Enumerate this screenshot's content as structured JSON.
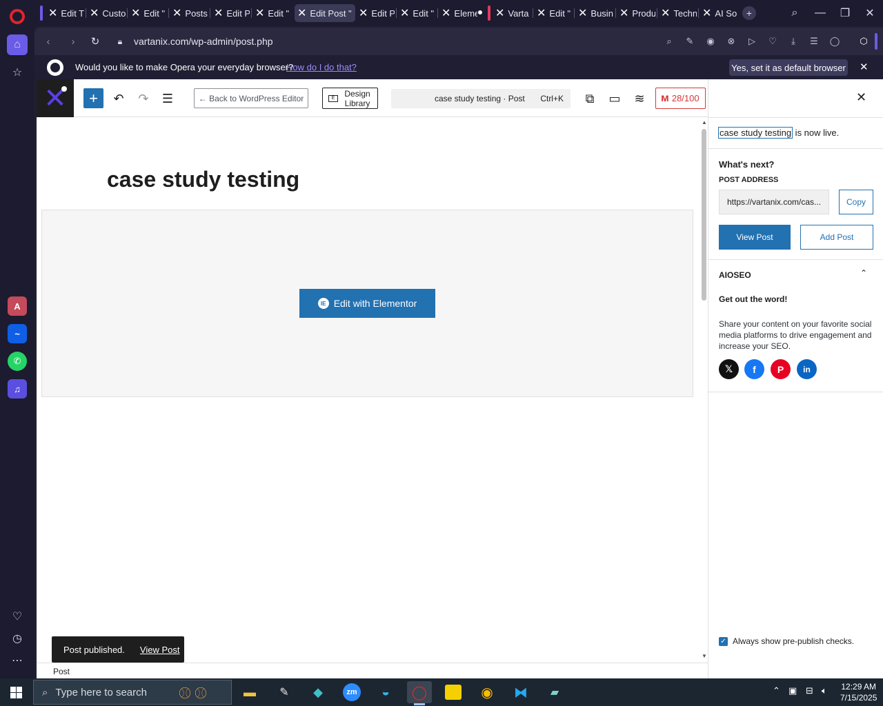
{
  "browser": {
    "tabs": [
      {
        "label": "Edit T"
      },
      {
        "label": "Custo"
      },
      {
        "label": "Edit \""
      },
      {
        "label": "Posts"
      },
      {
        "label": "Edit P"
      },
      {
        "label": "Edit \""
      },
      {
        "label": "Edit Post \""
      },
      {
        "label": "Edit P"
      },
      {
        "label": "Edit \""
      },
      {
        "label": "Eleme"
      },
      {
        "label": "Varta"
      },
      {
        "label": "Edit \""
      },
      {
        "label": "Busin"
      },
      {
        "label": "Produ"
      },
      {
        "label": "Techn"
      },
      {
        "label": "AI So"
      }
    ],
    "url": "vartanix.com/wp-admin/post.php",
    "infobar": {
      "text": "Would you like to make Opera your everyday browser?",
      "link": "How do I do that?",
      "button": "Yes, set it as default browser"
    }
  },
  "editor": {
    "back_label": "← Back to WordPress Editor",
    "design_library": "Design Library",
    "command": {
      "title": "case study testing · Post",
      "shortcut": "Ctrl+K"
    },
    "seo_score": "28/100",
    "post_title": "case study testing",
    "elementor_button": "Edit with Elementor",
    "snackbar": {
      "text": "Post published.",
      "link": "View Post"
    },
    "footer": "Post"
  },
  "panel": {
    "live_title": "case study testing",
    "live_suffix": " is now live.",
    "whats_next": "What's next?",
    "post_address_label": "POST ADDRESS",
    "post_address_value": "https://vartanix.com/cas...",
    "copy": "Copy",
    "view_post": "View Post",
    "add_post": "Add Post",
    "aioseo": "AIOSEO",
    "get_out": "Get out the word!",
    "share_text": "Share your content on your favorite social media platforms to drive engagement and increase your SEO.",
    "always_show": "Always show pre-publish checks."
  },
  "taskbar": {
    "search_placeholder": "Type here to search",
    "time": "12:29 AM",
    "date": "7/15/2025"
  },
  "colors": {
    "wp_blue": "#2271b1",
    "seo_red": "#d63638",
    "opera_purple": "#6b5ce7"
  }
}
